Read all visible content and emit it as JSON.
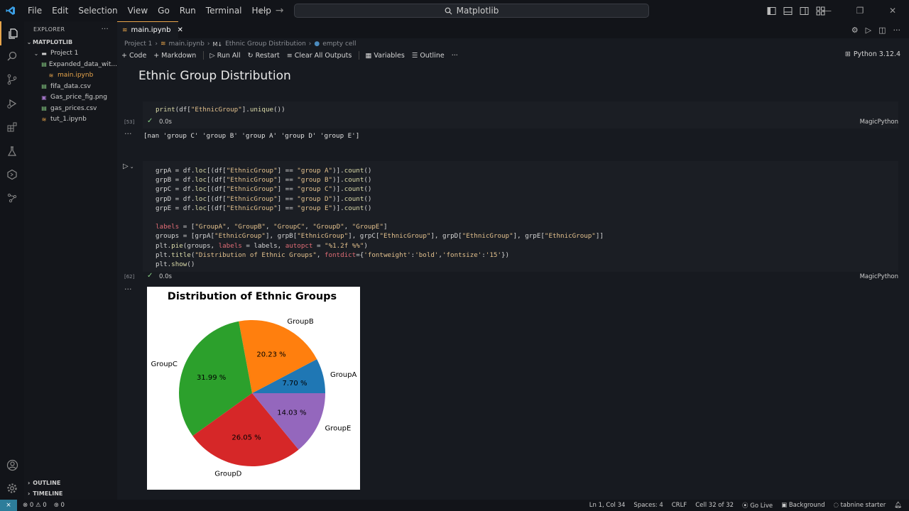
{
  "menu": [
    "File",
    "Edit",
    "Selection",
    "View",
    "Go",
    "Run",
    "Terminal",
    "Help"
  ],
  "search": {
    "text": "Matplotlib"
  },
  "sidebar": {
    "title": "EXPLORER",
    "root": "MATPLOTLIB",
    "items": [
      {
        "label": "Project 1",
        "indent": 1,
        "kind": "folder"
      },
      {
        "label": "Expanded_data_wit...",
        "indent": 2,
        "kind": "csv"
      },
      {
        "label": "main.ipynb",
        "indent": 2,
        "kind": "notebook",
        "active": true
      },
      {
        "label": "fifa_data.csv",
        "indent": 1,
        "kind": "csv"
      },
      {
        "label": "Gas_price_fig.png",
        "indent": 1,
        "kind": "image"
      },
      {
        "label": "gas_prices.csv",
        "indent": 1,
        "kind": "csv"
      },
      {
        "label": "tut_1.ipynb",
        "indent": 1,
        "kind": "notebook"
      }
    ],
    "outline": "OUTLINE",
    "timeline": "TIMELINE"
  },
  "tab": {
    "label": "main.ipynb"
  },
  "breadcrumb": [
    "Project 1",
    "main.ipynb",
    "Ethnic Group Distribution",
    "empty cell"
  ],
  "breadcrumb_md": "M↓",
  "toolbar": {
    "code": "Code",
    "markdown": "Markdown",
    "run_all": "Run All",
    "restart": "Restart",
    "clear": "Clear All Outputs",
    "variables": "Variables",
    "outline": "Outline",
    "more": "···"
  },
  "kernel": "Python 3.12.4",
  "heading": "Ethnic Group Distribution",
  "cell1": {
    "code": "print(df[\"EthnicGroup\"].unique())",
    "count": "[53]",
    "time": "0.0s",
    "lang": "MagicPython",
    "output": "[nan 'group C' 'group B' 'group A' 'group D' 'group E']"
  },
  "cell2": {
    "count": "[62]",
    "time": "0.0s",
    "lang": "MagicPython",
    "code_lines": [
      "grpA = df.loc[(df[\"EthnicGroup\"] == \"group A\")].count()",
      "grpB = df.loc[(df[\"EthnicGroup\"] == \"group B\")].count()",
      "grpC = df.loc[(df[\"EthnicGroup\"] == \"group C\")].count()",
      "grpD = df.loc[(df[\"EthnicGroup\"] == \"group D\")].count()",
      "grpE = df.loc[(df[\"EthnicGroup\"] == \"group E\")].count()",
      "",
      "labels = [\"GroupA\", \"GroupB\", \"GroupC\", \"GroupD\", \"GroupE\"]",
      "groups = [grpA[\"EthnicGroup\"], grpB[\"EthnicGroup\"], grpC[\"EthnicGroup\"], grpD[\"EthnicGroup\"], grpE[\"EthnicGroup\"]]",
      "plt.pie(groups, labels = labels, autopct = \"%1.2f %%\")",
      "plt.title(\"Distribution of Ethnic Groups\", fontdict={'fontweight':'bold','fontsize':'15'})",
      "plt.show()"
    ]
  },
  "chart_data": {
    "type": "pie",
    "title": "Distribution of Ethnic Groups",
    "categories": [
      "GroupA",
      "GroupB",
      "GroupC",
      "GroupD",
      "GroupE"
    ],
    "values": [
      7.7,
      20.23,
      31.99,
      26.05,
      14.03
    ],
    "value_labels": [
      "7.70 %",
      "20.23 %",
      "31.99 %",
      "26.05 %",
      "14.03 %"
    ],
    "colors": [
      "#1f77b4",
      "#ff7f0e",
      "#2ca02c",
      "#d62728",
      "#9467bd"
    ]
  },
  "status": {
    "problems": "0",
    "warnings": "0",
    "ports": "0",
    "position": "Ln 1, Col 34",
    "spaces": "Spaces: 4",
    "eol": "CRLF",
    "cell": "Cell 32 of 32",
    "golive": "Go Live",
    "background": "Background",
    "tabnine": "tabnine starter"
  },
  "accent": "#e8a54b"
}
